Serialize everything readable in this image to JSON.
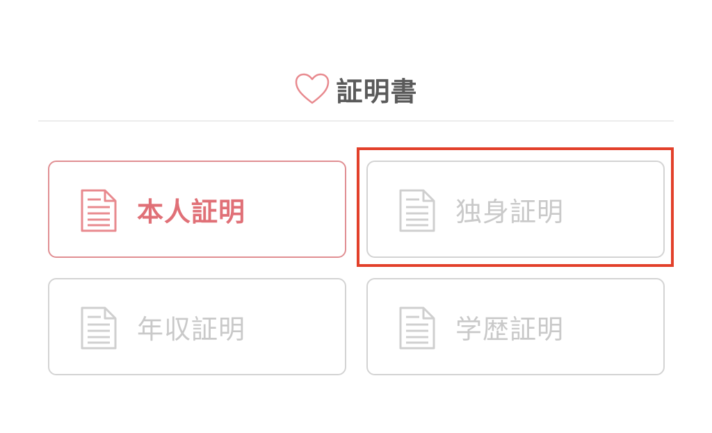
{
  "header": {
    "title": "証明書",
    "icon": "heart-outline-icon",
    "icon_color": "#e8898e"
  },
  "cards": [
    {
      "label": "本人証明",
      "icon": "document-icon",
      "active": true
    },
    {
      "label": "独身証明",
      "icon": "document-icon",
      "active": false
    },
    {
      "label": "年収証明",
      "icon": "document-icon",
      "active": false
    },
    {
      "label": "学歴証明",
      "icon": "document-icon",
      "active": false
    }
  ],
  "highlight": {
    "target_card": 1,
    "color": "#e2402a"
  },
  "colors": {
    "active_border": "#e08e92",
    "active_text": "#e07077",
    "inactive_border": "#d3d3d3",
    "inactive_text": "#c9c9c9",
    "title_text": "#5a5a5a"
  }
}
